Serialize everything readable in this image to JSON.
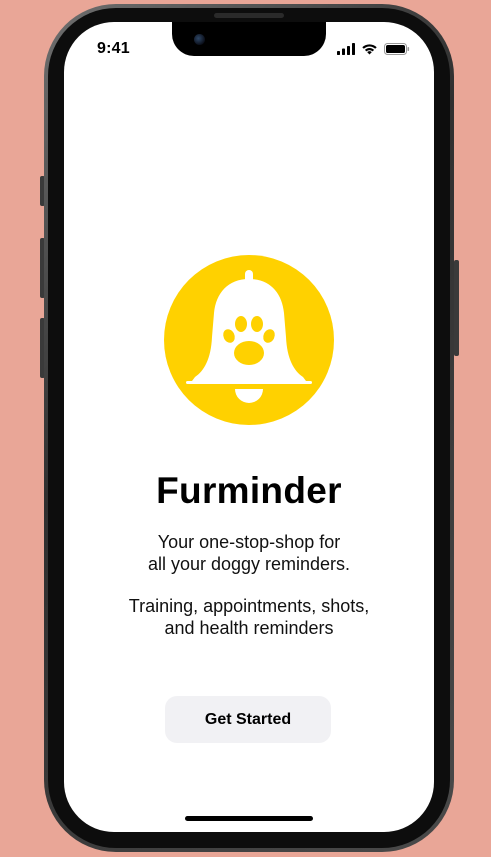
{
  "status_bar": {
    "time": "9:41",
    "icons": [
      "cellular-signal-icon",
      "wifi-icon",
      "battery-icon"
    ]
  },
  "app": {
    "logo_icon": "bell-paw-icon",
    "title": "Furminder",
    "tagline_lines": [
      "Your one-stop-shop for",
      "all your doggy reminders."
    ],
    "feature_lines": [
      "Training, appointments, shots,",
      "and health reminders"
    ],
    "cta_label": "Get Started"
  },
  "colors": {
    "background": "#e9a697",
    "brand_yellow": "#ffd100",
    "button_bg": "#f1f1f4"
  }
}
